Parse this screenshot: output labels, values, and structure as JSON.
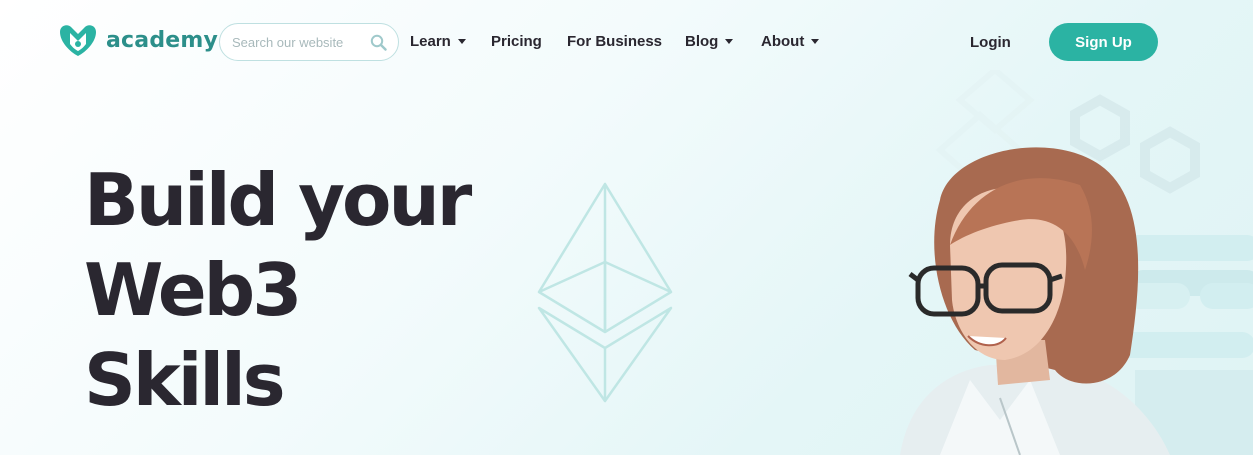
{
  "brand": {
    "name": "academy",
    "accent": "#2bb3a3",
    "logo_color": "#2c8f8a"
  },
  "search": {
    "placeholder": "Search our website",
    "icon": "search-icon"
  },
  "menu": [
    {
      "label": "Learn",
      "has_dropdown": true
    },
    {
      "label": "Pricing",
      "has_dropdown": false
    },
    {
      "label": "For Business",
      "has_dropdown": false
    },
    {
      "label": "Blog",
      "has_dropdown": true
    },
    {
      "label": "About",
      "has_dropdown": true
    }
  ],
  "auth": {
    "login_label": "Login",
    "signup_label": "Sign Up"
  },
  "hero": {
    "title_lines": [
      "Build your",
      "Web3",
      "Skills"
    ]
  }
}
